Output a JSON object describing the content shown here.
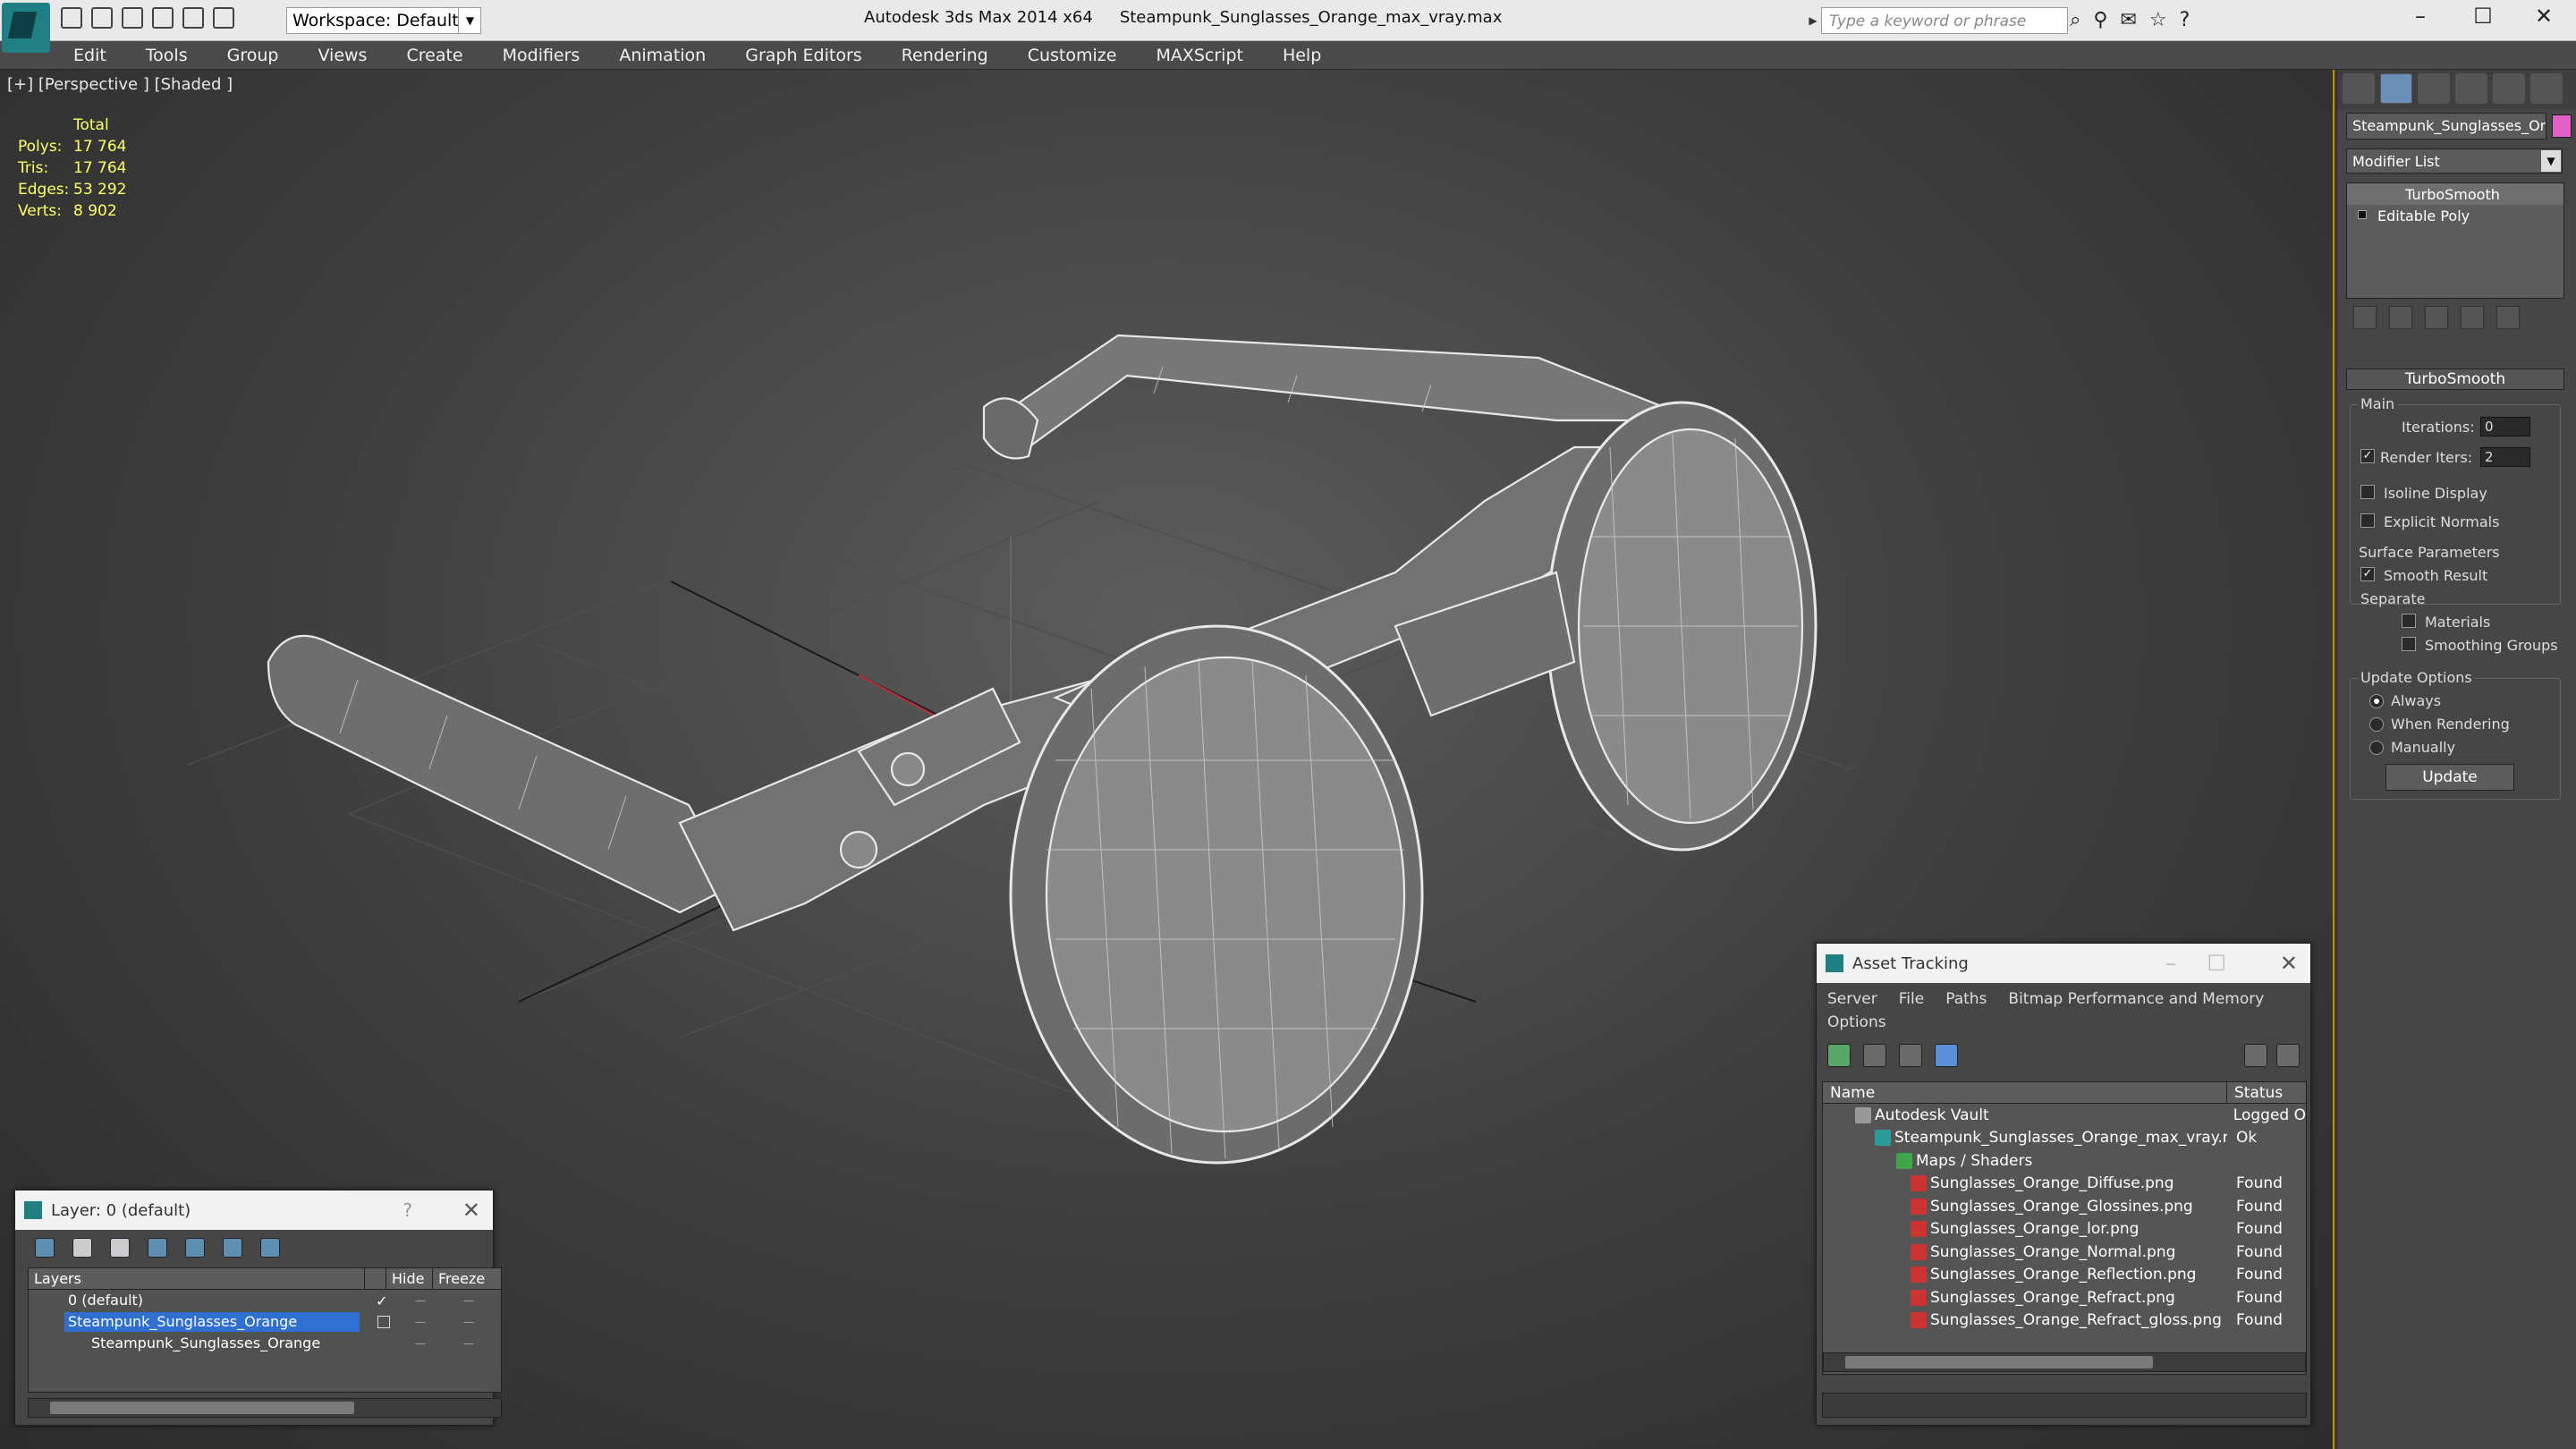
{
  "titlebar": {
    "app_title": "Autodesk 3ds Max  2014 x64",
    "file_name": "Steampunk_Sunglasses_Orange_max_vray.max",
    "workspace": "Workspace: Default",
    "search_placeholder": "Type a keyword or phrase"
  },
  "menu": [
    "Edit",
    "Tools",
    "Group",
    "Views",
    "Create",
    "Modifiers",
    "Animation",
    "Graph Editors",
    "Rendering",
    "Customize",
    "MAXScript",
    "Help"
  ],
  "viewport": {
    "label": "[+] [Perspective ] [Shaded ]",
    "stats": {
      "header": "Total",
      "polys_label": "Polys:",
      "polys": "17 764",
      "tris_label": "Tris:",
      "tris": "17 764",
      "edges_label": "Edges:",
      "edges": "53 292",
      "verts_label": "Verts:",
      "verts": "8 902"
    }
  },
  "command_panel": {
    "object_name": "Steampunk_Sunglasses_Orar",
    "object_color": "#e060c8",
    "modifier_list": "Modifier List",
    "stack": [
      "TurboSmooth",
      "Editable Poly"
    ],
    "rollout_title": "TurboSmooth",
    "main_group": "Main",
    "iterations_label": "Iterations:",
    "iterations_value": "0",
    "render_iters_label": "Render Iters:",
    "render_iters_value": "2",
    "isoline_label": "Isoline Display",
    "explicit_normals_label": "Explicit Normals",
    "surface_group": "Surface Parameters",
    "smooth_result_label": "Smooth Result",
    "separate_label": "Separate",
    "materials_label": "Materials",
    "smoothing_groups_label": "Smoothing Groups",
    "update_group": "Update Options",
    "always_label": "Always",
    "when_rendering_label": "When Rendering",
    "manually_label": "Manually",
    "update_button": "Update"
  },
  "layer_dialog": {
    "title": "Layer: 0 (default)",
    "help": "?",
    "col_layers": "Layers",
    "col_hide": "Hide",
    "col_freeze": "Freeze",
    "rows": [
      "0 (default)",
      "Steampunk_Sunglasses_Orange",
      "Steampunk_Sunglasses_Orange"
    ]
  },
  "asset_tracking": {
    "title": "Asset Tracking",
    "menu": [
      "Server",
      "File",
      "Paths",
      "Bitmap Performance and Memory",
      "Options"
    ],
    "col_name": "Name",
    "col_status": "Status",
    "rows": [
      {
        "name": "Autodesk Vault",
        "status": "Logged O"
      },
      {
        "name": "Steampunk_Sunglasses_Orange_max_vray.max",
        "status": "Ok"
      },
      {
        "name": "Maps / Shaders",
        "status": ""
      },
      {
        "name": "Sunglasses_Orange_Diffuse.png",
        "status": "Found"
      },
      {
        "name": "Sunglasses_Orange_Glossines.png",
        "status": "Found"
      },
      {
        "name": "Sunglasses_Orange_lor.png",
        "status": "Found"
      },
      {
        "name": "Sunglasses_Orange_Normal.png",
        "status": "Found"
      },
      {
        "name": "Sunglasses_Orange_Reflection.png",
        "status": "Found"
      },
      {
        "name": "Sunglasses_Orange_Refract.png",
        "status": "Found"
      },
      {
        "name": "Sunglasses_Orange_Refract_gloss.png",
        "status": "Found"
      }
    ]
  },
  "colors": {
    "accent_border": "#c98d00",
    "selection": "#2f6fcf",
    "stats_text": "#ffff66"
  }
}
